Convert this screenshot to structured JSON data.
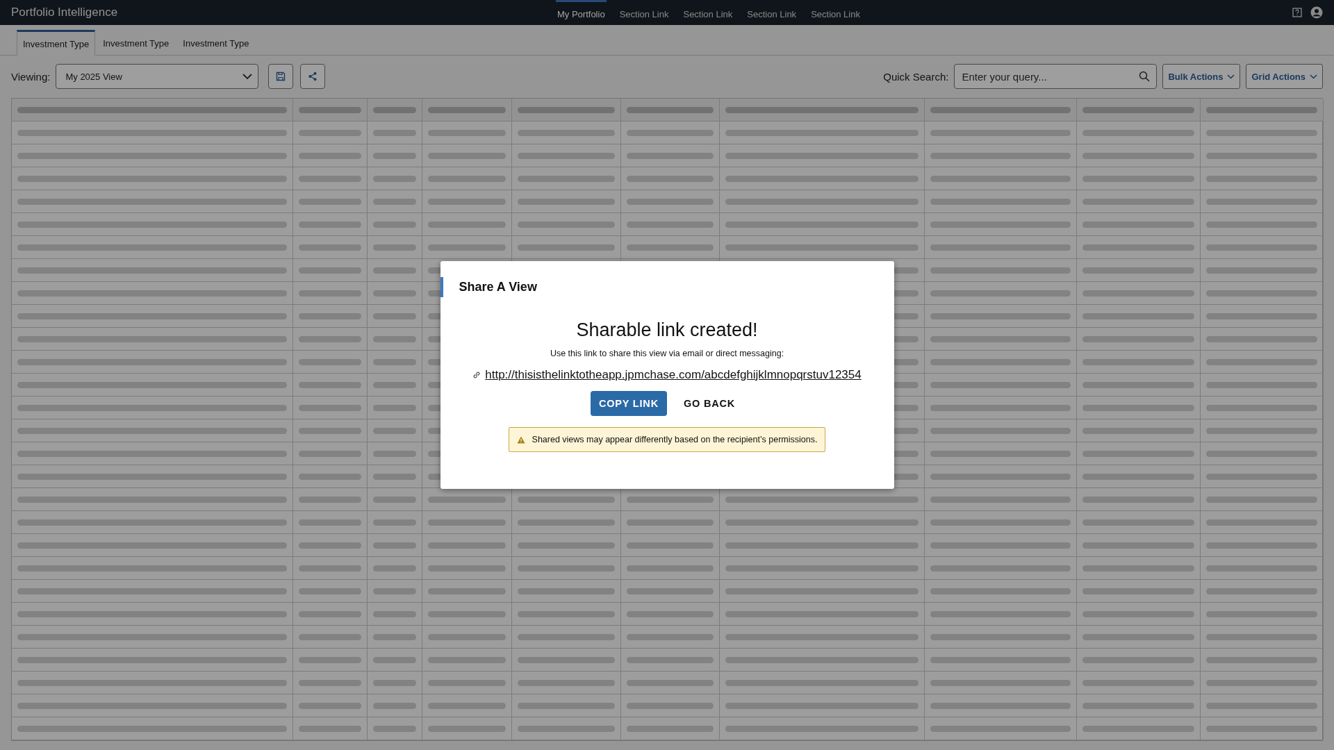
{
  "app": {
    "title": "Portfolio Intelligence"
  },
  "nav_links": [
    {
      "label": "My Portfolio",
      "selected": true
    },
    {
      "label": "Section Link",
      "selected": false
    },
    {
      "label": "Section Link",
      "selected": false
    },
    {
      "label": "Section Link",
      "selected": false
    },
    {
      "label": "Section Link",
      "selected": false
    }
  ],
  "tabs": [
    {
      "label": "Investment Type",
      "selected": true
    },
    {
      "label": "Investment Type",
      "selected": false
    },
    {
      "label": "Investment Type",
      "selected": false
    }
  ],
  "toolbar": {
    "viewing_label": "Viewing:",
    "view_select": {
      "value": "My 2025 View"
    },
    "quick_search_label": "Quick Search:",
    "search": {
      "placeholder": "Enter your query..."
    },
    "menus": [
      "Bulk Actions",
      "Grid Actions"
    ]
  },
  "dialog": {
    "title": "Share A View",
    "heading": "Sharable link created!",
    "instructions": "Use this link to share this view via email or direct messaging:",
    "link": "http://thisisthelinktotheapp.jpmchase.com/abcdefghijklmnopqrstuv12354",
    "buttons": [
      {
        "label": "COPY LINK",
        "kind": "primary"
      },
      {
        "label": "GO BACK",
        "kind": "text"
      }
    ],
    "warning": "Shared views may appear differently based on the recipient’s permissions."
  }
}
